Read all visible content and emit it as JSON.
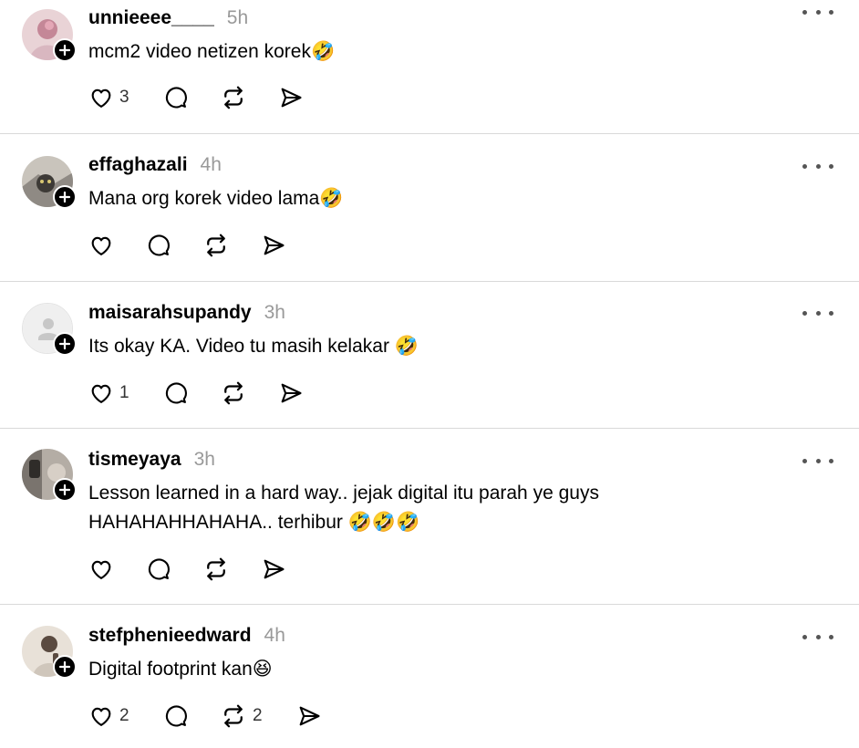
{
  "posts": [
    {
      "username": "unnieeee____",
      "time": "5h",
      "text_lines": [
        "mcm2 video netizen korek🤣"
      ],
      "likes": "3",
      "reposts": "",
      "avatar_colors": [
        "#d9b7c0",
        "#b27f8e",
        "#e9d3d6"
      ]
    },
    {
      "username": "effaghazali",
      "time": "4h",
      "text_lines": [
        "Mana org korek video lama🤣"
      ],
      "likes": "",
      "reposts": "",
      "avatar_colors": [
        "#8f8a84",
        "#3d3a36",
        "#c9c4bc"
      ]
    },
    {
      "username": "maisarahsupandy",
      "time": "3h",
      "text_lines": [
        "Its okay KA. Video tu masih kelakar 🤣"
      ],
      "likes": "1",
      "reposts": "",
      "avatar_colors": [
        "#efefef",
        "#c7c7c7",
        "#c7c7c7"
      ]
    },
    {
      "username": "tismeyaya",
      "time": "3h",
      "text_lines": [
        "Lesson learned in a hard way.. jejak digital itu parah ye guys",
        "HAHAHAHHAHAHA.. terhibur 🤣🤣🤣"
      ],
      "likes": "",
      "reposts": "",
      "avatar_colors": [
        "#7a746e",
        "#2f2c29",
        "#b4ada5"
      ]
    },
    {
      "username": "stefphenieedward",
      "time": "4h",
      "text_lines": [
        "Digital footprint kan😆"
      ],
      "likes": "2",
      "reposts": "2",
      "avatar_colors": [
        "#cfc6bb",
        "#5a4a40",
        "#e8e1d8"
      ]
    }
  ],
  "icons": {
    "like": "heart-icon",
    "reply": "comment-icon",
    "repost": "repost-icon",
    "share": "send-icon",
    "more": "more-icon",
    "follow": "plus-icon"
  },
  "colors": {
    "text": "#000000",
    "muted": "#999999",
    "divider": "#d9d9d9",
    "icon": "#000000"
  }
}
